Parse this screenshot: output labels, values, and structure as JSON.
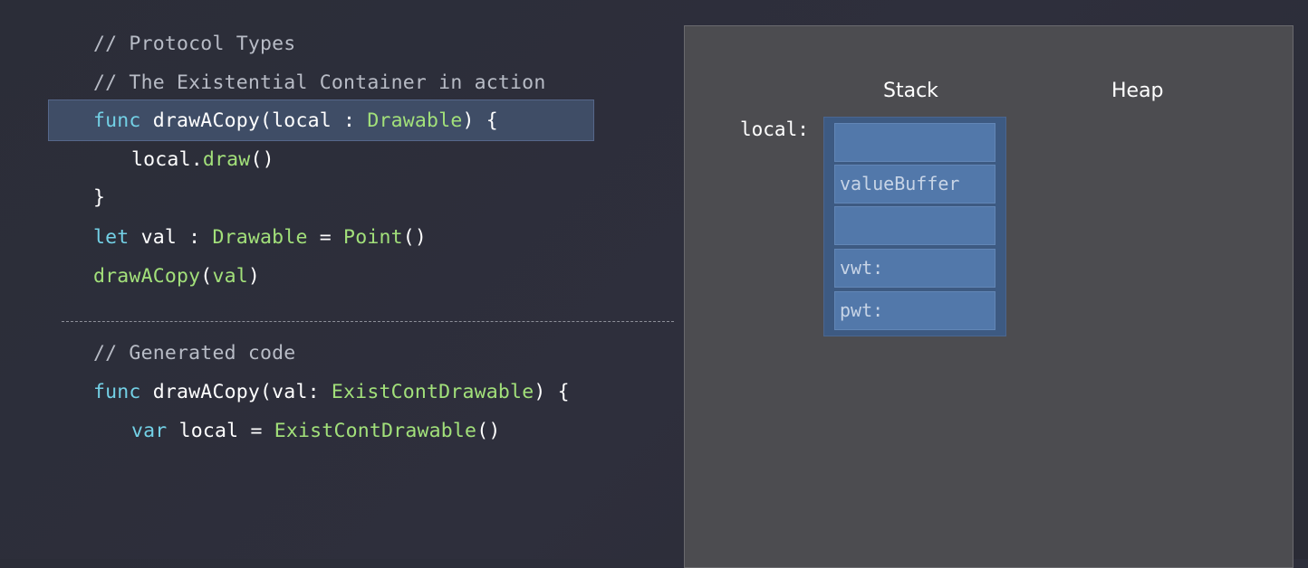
{
  "code": {
    "lines": [
      [
        {
          "t": "// Protocol Types",
          "c": "comment"
        }
      ],
      [
        {
          "t": "// The Existential Container in action",
          "c": "comment"
        }
      ],
      [
        {
          "t": "func",
          "c": "kw"
        },
        {
          "t": " drawACopy(local : ",
          "c": "plain"
        },
        {
          "t": "Drawable",
          "c": "type"
        },
        {
          "t": ") {",
          "c": "plain"
        }
      ],
      [
        {
          "t": "local.",
          "c": "plain"
        },
        {
          "t": "draw",
          "c": "type"
        },
        {
          "t": "()",
          "c": "plain"
        }
      ],
      [
        {
          "t": "}",
          "c": "plain"
        }
      ],
      [
        {
          "t": "let",
          "c": "kw"
        },
        {
          "t": " val : ",
          "c": "plain"
        },
        {
          "t": "Drawable",
          "c": "type"
        },
        {
          "t": " = ",
          "c": "plain"
        },
        {
          "t": "Point",
          "c": "type"
        },
        {
          "t": "()",
          "c": "plain"
        }
      ],
      [
        {
          "t": "drawACopy",
          "c": "type"
        },
        {
          "t": "(",
          "c": "plain"
        },
        {
          "t": "val",
          "c": "type"
        },
        {
          "t": ")",
          "c": "plain"
        }
      ],
      [
        {
          "t": "// Generated code",
          "c": "comment"
        }
      ],
      [
        {
          "t": "func",
          "c": "kw"
        },
        {
          "t": " drawACopy(val: ",
          "c": "plain"
        },
        {
          "t": "ExistContDrawable",
          "c": "type"
        },
        {
          "t": ") {",
          "c": "plain"
        }
      ],
      [
        {
          "t": "var",
          "c": "kw"
        },
        {
          "t": " local = ",
          "c": "plain"
        },
        {
          "t": "ExistContDrawable",
          "c": "type"
        },
        {
          "t": "()",
          "c": "plain"
        }
      ]
    ],
    "highlighted_line_index": 2
  },
  "diagram": {
    "stack_label": "Stack",
    "heap_label": "Heap",
    "variable_label": "local:",
    "cells": [
      "",
      "valueBuffer",
      "",
      "vwt:",
      "pwt:"
    ]
  },
  "colors": {
    "keyword": "#73d1e6",
    "type": "#a2e07a",
    "comment": "#b8bcc6",
    "highlight": "#3f4d66",
    "container": "#3d5a82",
    "cell": "#5278aa"
  }
}
